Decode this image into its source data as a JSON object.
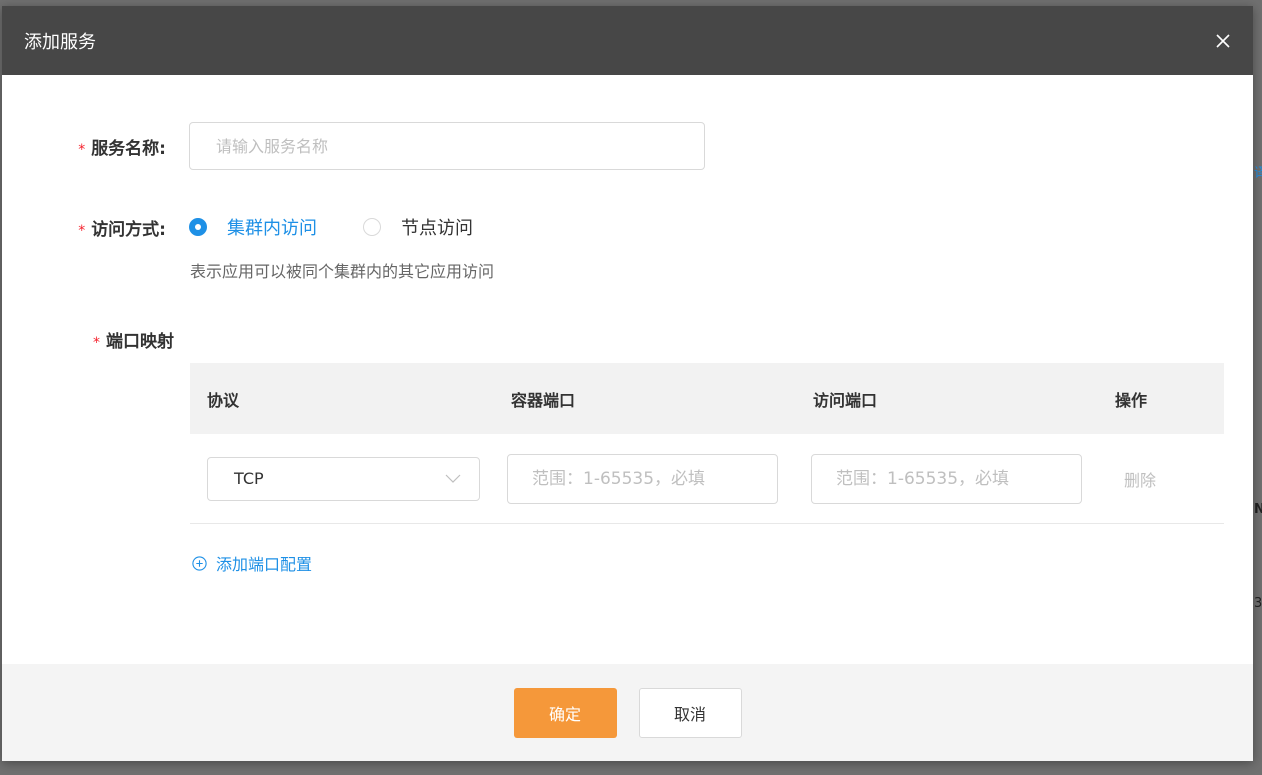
{
  "dialog": {
    "title": "添加服务",
    "close_icon": "close-icon"
  },
  "form": {
    "service_name": {
      "label": "服务名称:",
      "value": "",
      "placeholder": "请输入服务名称"
    },
    "access_mode": {
      "label": "访问方式:",
      "options": [
        "集群内访问",
        "节点访问"
      ],
      "selected": "集群内访问",
      "hint": "表示应用可以被同个集群内的其它应用访问"
    },
    "port_mapping": {
      "label": "端口映射",
      "columns": [
        "协议",
        "容器端口",
        "访问端口",
        "操作"
      ],
      "rows": [
        {
          "protocol": "TCP",
          "container_port": "",
          "container_port_placeholder": "范围：1-65535，必填",
          "access_port": "",
          "access_port_placeholder": "范围：1-65535，必填",
          "action": "删除"
        }
      ],
      "add_label": "添加端口配置"
    }
  },
  "footer": {
    "confirm_label": "确定",
    "cancel_label": "取消"
  },
  "colors": {
    "primary_blue": "#1e90e6",
    "confirm_orange": "#f5983a",
    "header_bg": "#474747",
    "required_red": "#f5222d"
  }
}
